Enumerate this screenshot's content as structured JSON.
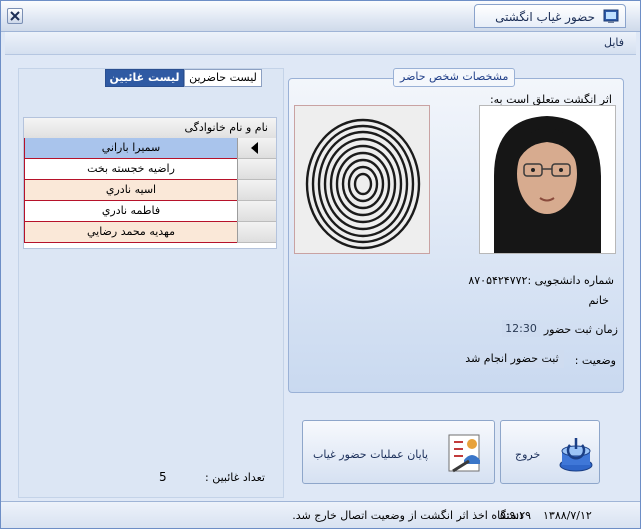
{
  "window": {
    "title": "حضور غیاب انگشتی"
  },
  "menu": {
    "file": "فایل"
  },
  "tabs": {
    "absent_list": "لیست غائبین",
    "present_list": "لیست حاضرین"
  },
  "grid": {
    "header": "نام و نام خانوادگی",
    "rows": [
      {
        "name": "سميرا باراني",
        "bg": "#a9c4ec"
      },
      {
        "name": "راضيه خجسته بخت",
        "bg": "#ffffff"
      },
      {
        "name": "اسيه نادري",
        "bg": "#fae8d8"
      },
      {
        "name": "فاطمه نادري",
        "bg": "#ffffff"
      },
      {
        "name": "مهديه محمد رضايي",
        "bg": "#fae8d8"
      }
    ]
  },
  "absent": {
    "label": "تعداد غائبین :",
    "count": "5"
  },
  "person": {
    "group_title": "مشخصات شخص حاضر",
    "fingerprint_label": "اثر انگشت متعلق است به:",
    "student_id": "شماره دانشجویی :۸۷۰۵۴۲۴۷۷۲",
    "gender": "خانم",
    "time_label": "زمان ثبت حضور",
    "time_value": "12:30",
    "status_label": "وضعیت :",
    "status_value": "ثبت حضور انجام شد"
  },
  "buttons": {
    "exit": "خروج",
    "end": "پایان عملیات حضور غیاب"
  },
  "statusbar": {
    "message": "دستگاه اخذ اثر انگشت از وضعیت اتصال خارج شد.",
    "date": "۱۳۸۸/۷/۱۲",
    "time": "۵:۹:۲۹"
  },
  "colors": {
    "accent": "#2f5aa3",
    "row_border": "#b6122a"
  },
  "icons": [
    "close-icon",
    "app-icon",
    "row-pointer-icon",
    "student-photo",
    "fingerprint-image",
    "exit-icon",
    "end-operations-icon"
  ]
}
